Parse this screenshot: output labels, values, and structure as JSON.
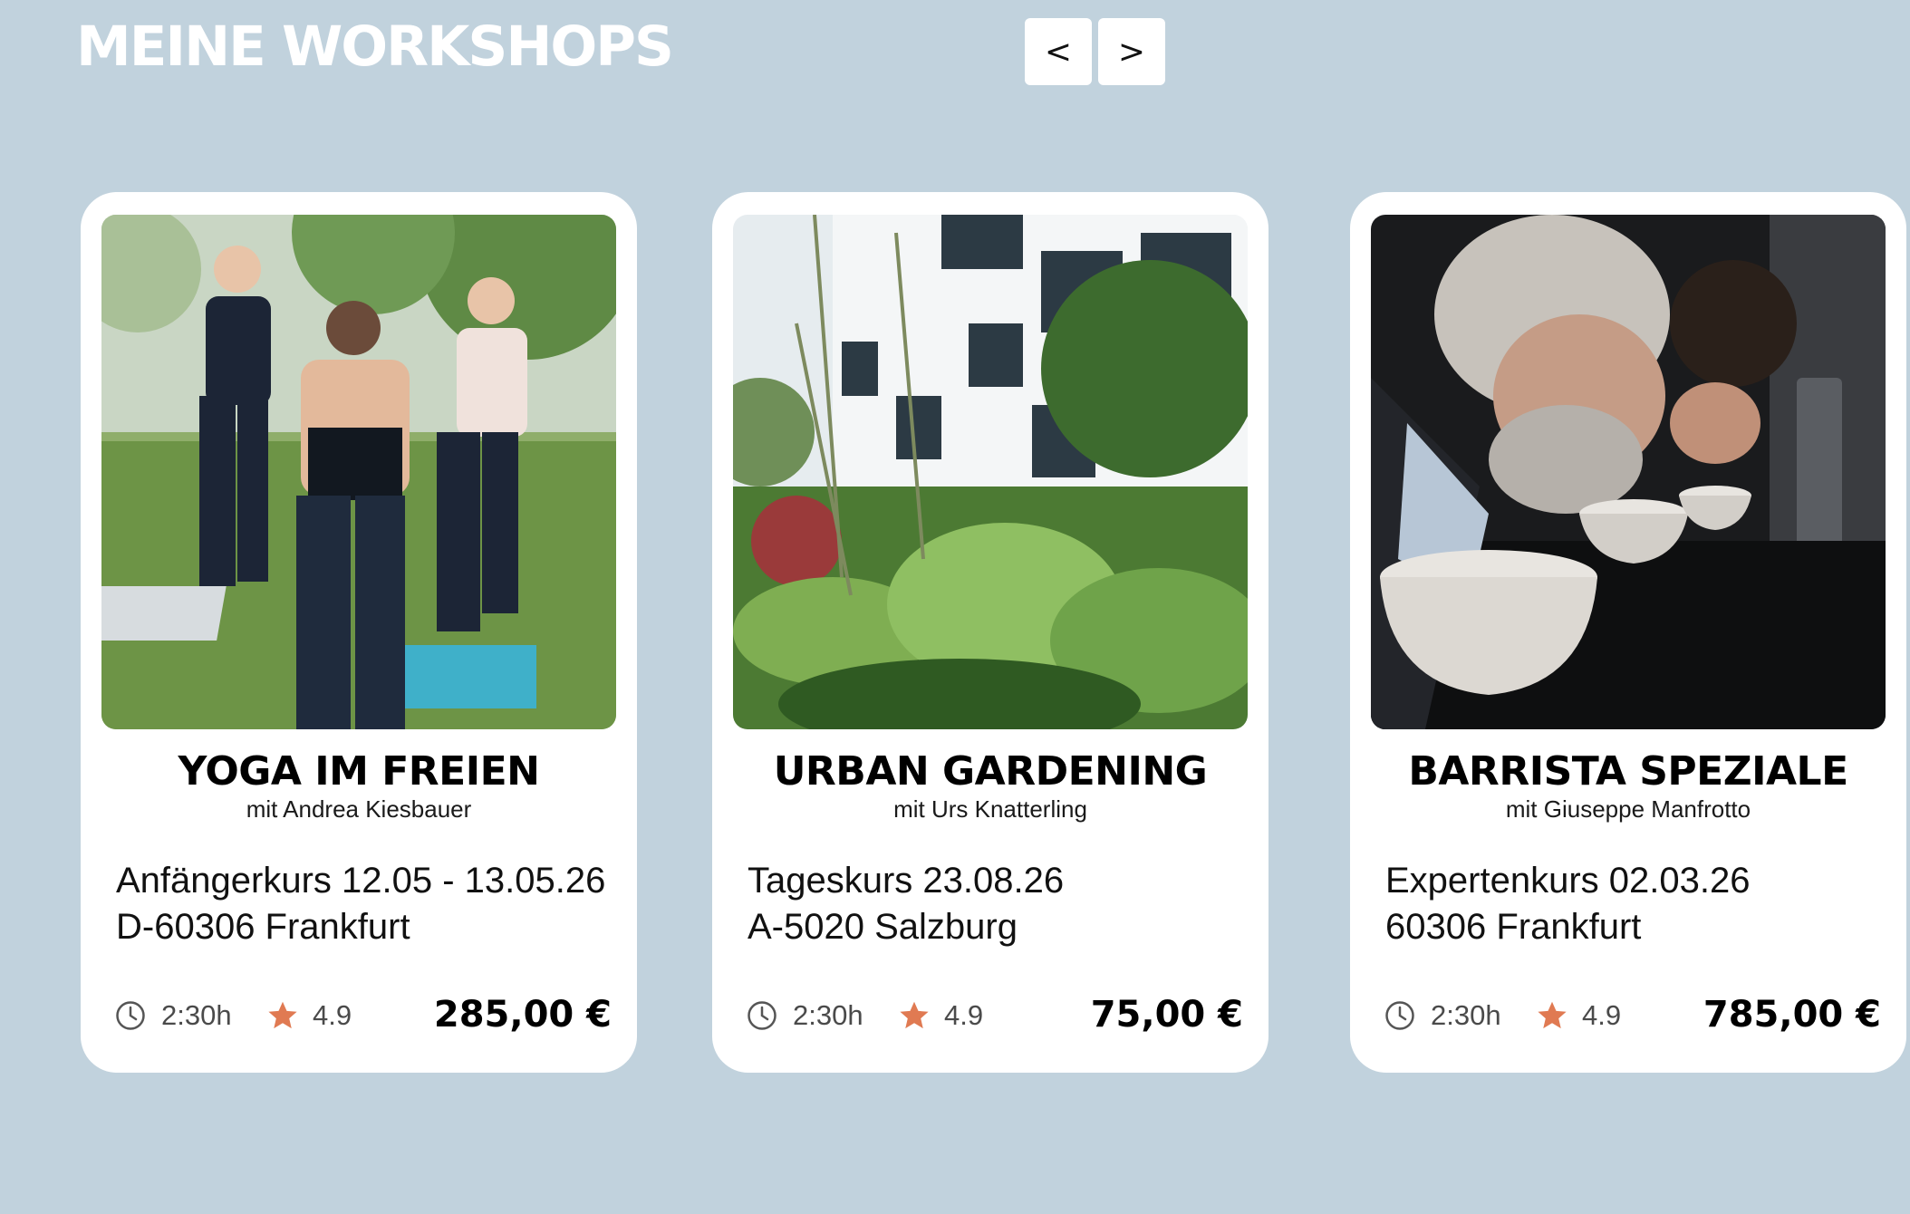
{
  "header": {
    "title": "MEINE WORKSHOPS",
    "prev_label": "<",
    "next_label": ">"
  },
  "colors": {
    "background": "#c1d2dd",
    "card": "#ffffff",
    "star": "#e07a52",
    "text": "#000000"
  },
  "workshops": [
    {
      "title": "YOGA IM FREIEN",
      "instructor": "mit Andrea Kiesbauer",
      "course": "Anfängerkurs 12.05 - 13.05.26",
      "location": "D-60306 Frankfurt",
      "duration": "2:30h",
      "rating": "4.9",
      "price": "285,00 €",
      "image": "yoga-group-outdoors-photo"
    },
    {
      "title": "URBAN GARDENING",
      "instructor": "mit Urs Knatterling",
      "course": "Tageskurs 23.08.26",
      "location": "A-5020 Salzburg",
      "duration": "2:30h",
      "rating": "4.9",
      "price": "75,00 €",
      "image": "urban-garden-plants-photo"
    },
    {
      "title": "BARRISTA SPEZIALE",
      "instructor": "mit Giuseppe Manfrotto",
      "course": "Expertenkurs 02.03.26",
      "location": "60306 Frankfurt",
      "duration": "2:30h",
      "rating": "4.9",
      "price": "785,00 €",
      "image": "coffee-cupping-photo"
    }
  ],
  "icons": {
    "duration": "clock-icon",
    "rating": "star-icon"
  }
}
